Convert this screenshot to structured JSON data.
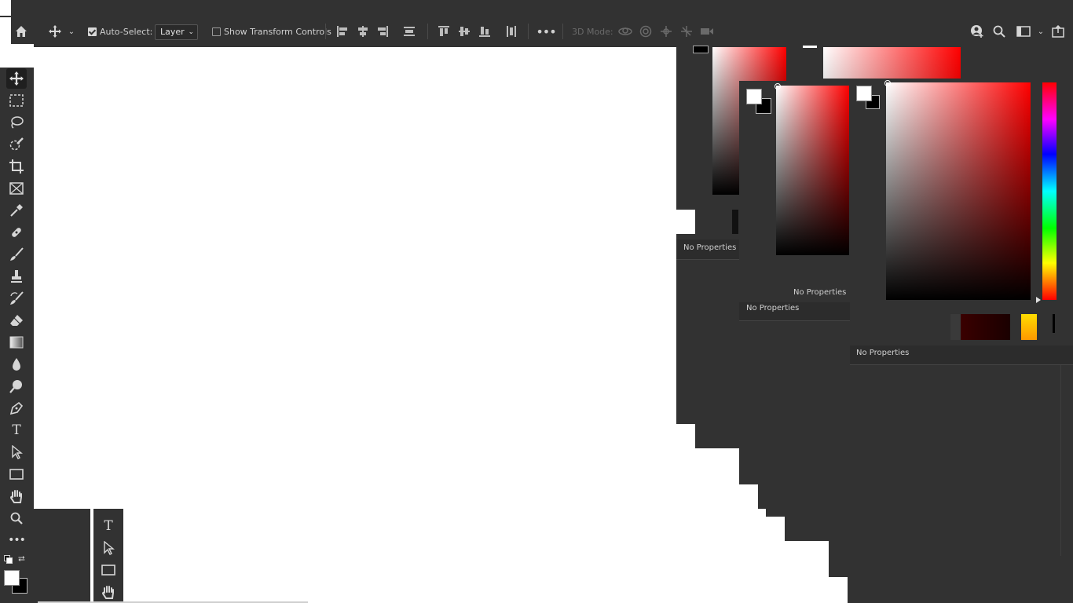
{
  "options_bar": {
    "auto_select_label": "Auto-Select:",
    "auto_select_checked": true,
    "layer_dropdown_value": "Layer",
    "show_transform_label": "Show Transform Controls",
    "show_transform_checked": false,
    "mode_3d_label": "3D Mode:",
    "more_icon": "ellipsis-icon"
  },
  "tools": [
    "move-tool",
    "rectangular-marquee-tool",
    "lasso-tool",
    "quick-selection-tool",
    "crop-tool",
    "frame-tool",
    "eyedropper-tool",
    "spot-healing-tool",
    "brush-tool",
    "clone-stamp-tool",
    "history-brush-tool",
    "eraser-tool",
    "gradient-tool",
    "blur-tool",
    "dodge-tool",
    "pen-tool",
    "type-tool",
    "path-selection-tool",
    "rectangle-tool",
    "hand-tool",
    "zoom-tool",
    "edit-toolbar"
  ],
  "panels": {
    "properties_label_1": "No Properties",
    "properties_label_2": "No Properties",
    "properties_label_3": "No Properties",
    "properties_label_4": "No Properties"
  },
  "colors": {
    "panel_bg": "#323232",
    "hue": "#ff0000",
    "foreground": "#ffffff",
    "background": "#000000",
    "swatch_dark_red": "#3a0000",
    "swatch_gold": "#ffcc00"
  }
}
